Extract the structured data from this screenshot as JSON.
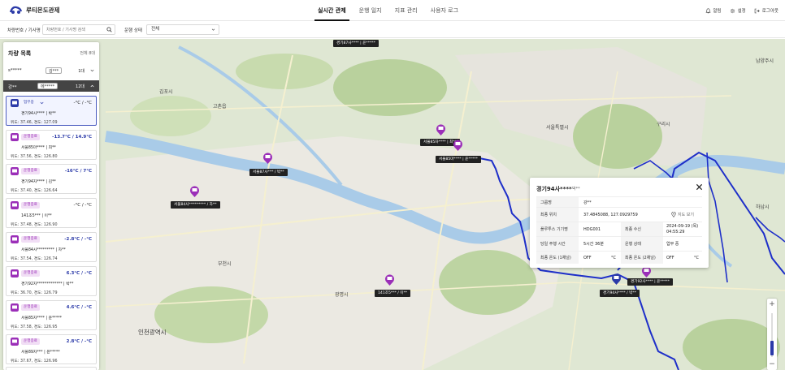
{
  "app": {
    "title": "루티몬도관제"
  },
  "nav": {
    "tabs": [
      {
        "label": "실시간 관제"
      },
      {
        "label": "운행 일지"
      },
      {
        "label": "지표 관리"
      },
      {
        "label": "사용자 로그"
      }
    ]
  },
  "header_actions": {
    "alarm": "알림",
    "settings": "설정",
    "logout": "로그아웃"
  },
  "filter": {
    "search_label": "차량번호 / 기사명",
    "search_placeholder": "차량번호 / 기사명 검색",
    "status_label": "운행 상태",
    "status_value": "전체"
  },
  "sidebar": {
    "title": "차량 목록",
    "total": "전체 8대",
    "rows": [
      {
        "name": "s*****",
        "pill": "김***",
        "count": "1대"
      },
      {
        "name": "강**",
        "pill": "에*****",
        "count": "12대"
      }
    ],
    "cards": [
      {
        "badge": "업무중",
        "temp": "-°C / -°C",
        "plate": "경기94사**** | 박**",
        "coord": "위도: 37.46, 경도: 127.09"
      },
      {
        "badge": "운행종료",
        "temp": "-13.7°C / 14.9°C",
        "plate": "서울85마**** | 최**",
        "coord": "위도: 37.56, 경도: 126.80"
      },
      {
        "badge": "운행종료",
        "temp": "-16°C / 7°C",
        "plate": "경기94자**** | 김**",
        "coord": "위도: 37.40, 경도: 126.64"
      },
      {
        "badge": "운행종료",
        "temp": "-°C / -°C",
        "plate": "141조5*** | 이**",
        "coord": "위도: 37.48, 경도: 126.90"
      },
      {
        "badge": "운행종료",
        "temp": "-2.8°C / -°C",
        "plate": "서울84사********* | 차**",
        "coord": "위도: 37.54, 경도: 126.74"
      },
      {
        "badge": "운행종료",
        "temp": "6.3°C / -°C",
        "plate": "경기92자************* | 박**",
        "coord": "위도: 36.70, 경도: 126.79"
      },
      {
        "badge": "운행종료",
        "temp": "4.6°C / -°C",
        "plate": "서울85자**** | 윤*****",
        "coord": "위도: 37.58, 경도: 126.95"
      },
      {
        "badge": "운행종료",
        "temp": "2.8°C / -°C",
        "plate": "서울89자*** | 윤*****",
        "coord": "위도: 37.67, 경도: 126.96"
      }
    ]
  },
  "markers": [
    {
      "label": "경기87사**** | 윤*****"
    },
    {
      "label": "서울85자**** | 최**"
    },
    {
      "label": "서울85마**** | 윤*****"
    },
    {
      "label": "서울87사*** / 박**"
    },
    {
      "label": "서울84사********* / 차**"
    },
    {
      "label": "141조5*** / 이**"
    },
    {
      "label": "경기92사**** | 윤*****"
    },
    {
      "label": "경기94사**** / 박**"
    }
  ],
  "map_labels": {
    "gimpo": "김포시",
    "goyang": "고촌읍",
    "guri": "구리시",
    "namyangju": "남양주시",
    "hanam": "하남시",
    "bucheon": "부천시",
    "gwangmyeong": "광명시",
    "incheon": "인천광역시",
    "seoul": "서울특별시"
  },
  "popup": {
    "title": "경기94사****",
    "subtitle": "박**",
    "rows": [
      {
        "k": "그룹명",
        "v": "강**"
      },
      {
        "k": "최종 위치",
        "v": "37.4845088, 127.0929759",
        "link": "지도 보기"
      },
      {
        "k": "플루투스 기기명",
        "v": "HDG001",
        "k2": "최종 수신",
        "v2": "2024-09-19 (목) 04:55:29"
      },
      {
        "k": "당일 주행 시간",
        "v": "5시간 36분",
        "k2": "운행 상태",
        "v2": "업무 중"
      },
      {
        "k": "최종 온도 (1채널)",
        "v": "OFF",
        "u": "°C",
        "k2": "최종 온도 (2채널)",
        "v2": "OFF",
        "u2": "°C"
      }
    ]
  },
  "colors": {
    "accent": "#2b3aa8",
    "purple": "#9b2fb8",
    "route": "#1e2fc9",
    "water": "#a9cbe8",
    "park": "#b7cf9a"
  }
}
